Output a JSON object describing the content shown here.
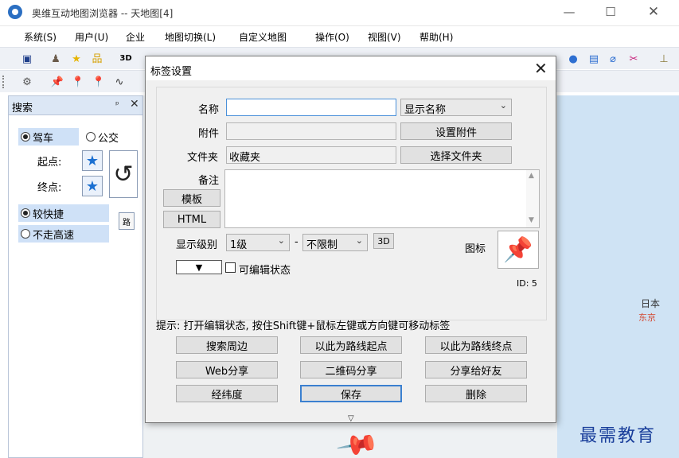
{
  "window": {
    "title": "奥维互动地图浏览器 -- 天地图[4]",
    "controls": {
      "minimize": "—",
      "maximize": "☐",
      "close": "✕"
    }
  },
  "menu": [
    "系统(S)",
    "用户(U)",
    "企业",
    "地图切换(L)",
    "自定义地图",
    "操作(O)",
    "视图(V)",
    "帮助(H)"
  ],
  "toolbar": {
    "label_3d": "3D"
  },
  "search_panel": {
    "title": "搜索",
    "pin": "ᵖ",
    "close": "✕",
    "mode_drive": "驾车",
    "mode_bus": "公交",
    "start_label": "起点:",
    "end_label": "终点:",
    "opt_faster": "较快捷",
    "opt_no_highway": "不走高速",
    "route_icon": "路"
  },
  "map": {
    "country": "日本",
    "city": "东京",
    "watermark": "最需教育"
  },
  "dialog": {
    "title": "标签设置",
    "close": "✕",
    "name_label": "名称",
    "name_value": "",
    "name_mode": "显示名称",
    "attach_label": "附件",
    "attach_value": "",
    "attach_button": "设置附件",
    "folder_label": "文件夹",
    "folder_value": "收藏夹",
    "folder_button": "选择文件夹",
    "notes_label": "备注",
    "template_button": "模板",
    "html_button": "HTML",
    "level_label": "显示级别",
    "level_min": "1级",
    "level_sep": "-",
    "level_max": "不限制",
    "btn_3d": "3D",
    "icon_label": "图标",
    "editable_label": "可编辑状态",
    "id_text": "ID: 5",
    "tip": "提示: 打开编辑状态, 按住Shift键+鼠标左键或方向键可移动标签",
    "actions": {
      "search_nearby": "搜索周边",
      "route_start": "以此为路线起点",
      "route_end": "以此为路线终点",
      "web_share": "Web分享",
      "qr_share": "二维码分享",
      "share_friend": "分享给好友",
      "latlng": "经纬度",
      "save": "保存",
      "delete": "删除"
    }
  }
}
